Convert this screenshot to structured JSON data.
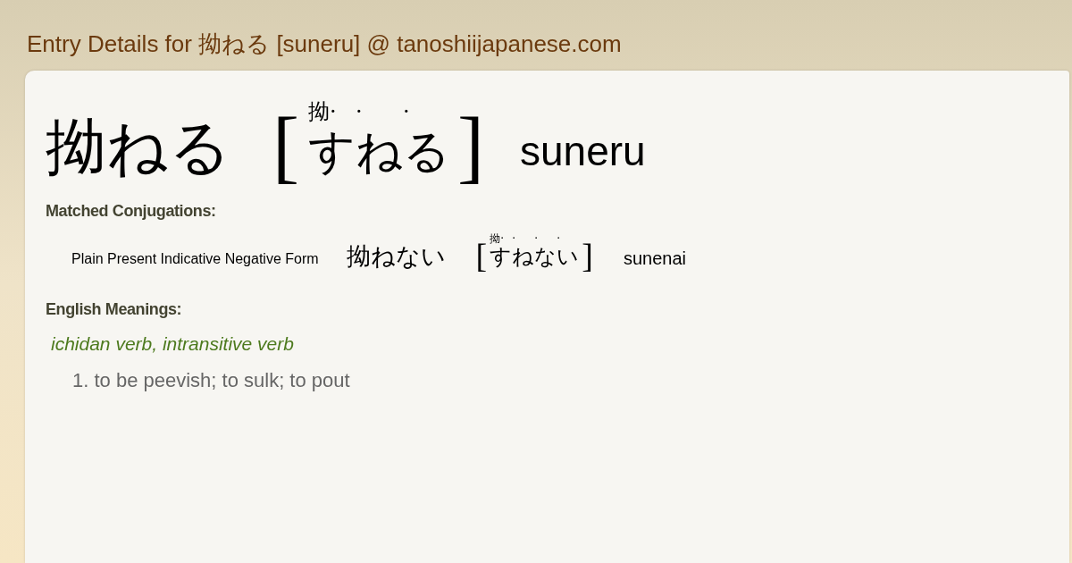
{
  "page_title": "Entry Details for 拗ねる [suneru] @ tanoshiijapanese.com",
  "entry": {
    "word": "拗ねる",
    "brackets": [
      "[",
      "]"
    ],
    "reading": [
      {
        "kana": "す",
        "mark": "拗·"
      },
      {
        "kana": "ね",
        "mark": "·"
      },
      {
        "kana": "る",
        "mark": "·"
      }
    ],
    "romaji": "suneru"
  },
  "conjugations": {
    "heading": "Matched Conjugations:",
    "items": [
      {
        "form": "Plain Present Indicative Negative Form",
        "word": "拗ねない",
        "brackets": [
          "[",
          "]"
        ],
        "reading": [
          {
            "kana": "す",
            "mark": "拗·"
          },
          {
            "kana": "ね",
            "mark": "·"
          },
          {
            "kana": "な",
            "mark": "·"
          },
          {
            "kana": "い",
            "mark": "·"
          }
        ],
        "romaji": "sunenai"
      }
    ]
  },
  "meanings": {
    "heading": "English Meanings:",
    "part_of_speech": "ichidan verb, intransitive verb",
    "definitions": [
      "1. to be peevish; to sulk; to pout"
    ]
  }
}
